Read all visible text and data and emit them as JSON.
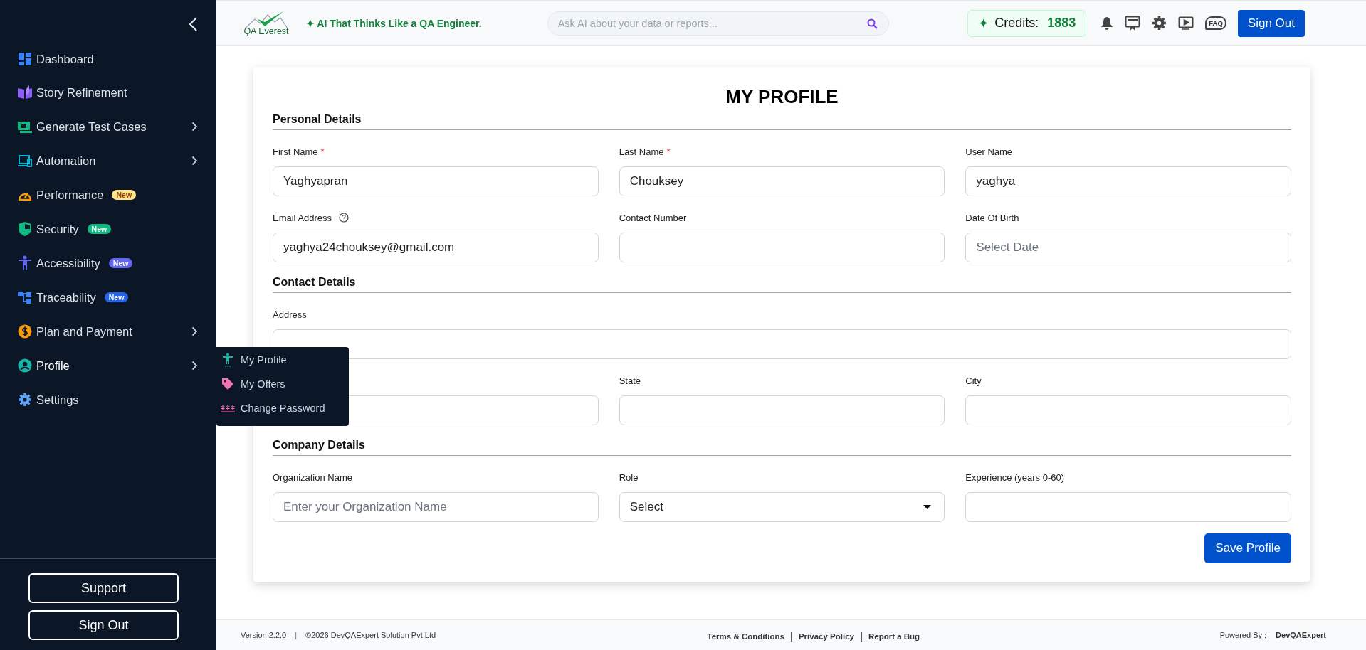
{
  "sidebar": {
    "items": [
      {
        "label": "Dashboard",
        "expandable": false,
        "expanded": false
      },
      {
        "label": "Story Refinement",
        "expandable": false,
        "expanded": false
      },
      {
        "label": "Generate Test Cases",
        "expandable": true,
        "expanded": false
      },
      {
        "label": "Automation",
        "expandable": true,
        "expanded": false
      },
      {
        "label": "Performance",
        "expandable": false,
        "expanded": false,
        "badge": {
          "text": "New",
          "color": "#fde68a"
        }
      },
      {
        "label": "Security",
        "expandable": false,
        "expanded": false,
        "badge": {
          "text": "New",
          "color": "#10b981"
        }
      },
      {
        "label": "Accessibility",
        "expandable": false,
        "expanded": false,
        "badge": {
          "text": "New",
          "color": "#6366f1"
        }
      },
      {
        "label": "Traceability",
        "expandable": false,
        "expanded": false,
        "badge": {
          "text": "New",
          "color": "#2563eb"
        }
      },
      {
        "label": "Plan and Payment",
        "expandable": true,
        "expanded": false
      },
      {
        "label": "Profile",
        "expandable": true,
        "expanded": true,
        "submenu": [
          {
            "label": "My Profile"
          },
          {
            "label": "My Offers"
          },
          {
            "label": "Change Password"
          }
        ]
      },
      {
        "label": "Settings",
        "expandable": false,
        "expanded": false
      }
    ],
    "buttons": [
      "Support",
      "Sign Out"
    ]
  },
  "header": {
    "logo_text": "QA Everest",
    "tagline": "✦ AI That Thinks Like a QA Engineer.",
    "search": {
      "placeholder": "Ask AI about your data or reports..."
    },
    "credits": {
      "symbol": "✦",
      "label": "Credits:",
      "value": "1883"
    },
    "faq_label": "FAQ",
    "sign_out": "Sign Out"
  },
  "profile": {
    "title": "MY PROFILE",
    "sections": [
      {
        "heading": "Personal Details",
        "fields": [
          {
            "label": "First Name",
            "required_mark": "*",
            "kind": "text",
            "value": "Yaghyapran"
          },
          {
            "label": "Last Name",
            "required_mark": "*",
            "kind": "text",
            "value": "Chouksey"
          },
          {
            "label": "User Name",
            "kind": "text",
            "value": "yaghya"
          },
          {
            "label": "Email Address",
            "help": true,
            "kind": "text",
            "value": "yaghya24chouksey@gmail.com"
          },
          {
            "label": "Contact Number",
            "kind": "text"
          },
          {
            "label": "Date Of Birth",
            "kind": "text",
            "placeholder": "Select Date"
          }
        ]
      },
      {
        "heading": "Contact Details",
        "fields": [
          {
            "label": "Address",
            "kind": "text",
            "wide": true
          },
          {
            "kind": "text"
          },
          {
            "label": "State",
            "kind": "text"
          },
          {
            "label": "City",
            "kind": "text"
          }
        ]
      },
      {
        "heading": "Company Details",
        "fields": [
          {
            "label": "Organization Name",
            "kind": "text",
            "placeholder": "Enter your Organization Name"
          },
          {
            "label": "Role",
            "kind": "select",
            "value": "Select"
          },
          {
            "label": "Experience (years 0-60)",
            "kind": "text"
          }
        ]
      }
    ],
    "save": "Save Profile"
  },
  "footer": {
    "version": "Version 2.2.0",
    "separator": "|",
    "copyright": "©2026 DevQAExpert Solution Pvt Ltd",
    "links": [
      "Terms & Conditions",
      "Privacy Policy",
      "Report a Bug"
    ],
    "powered_label": "Powered By :",
    "powered_by": "DevQAExpert"
  }
}
